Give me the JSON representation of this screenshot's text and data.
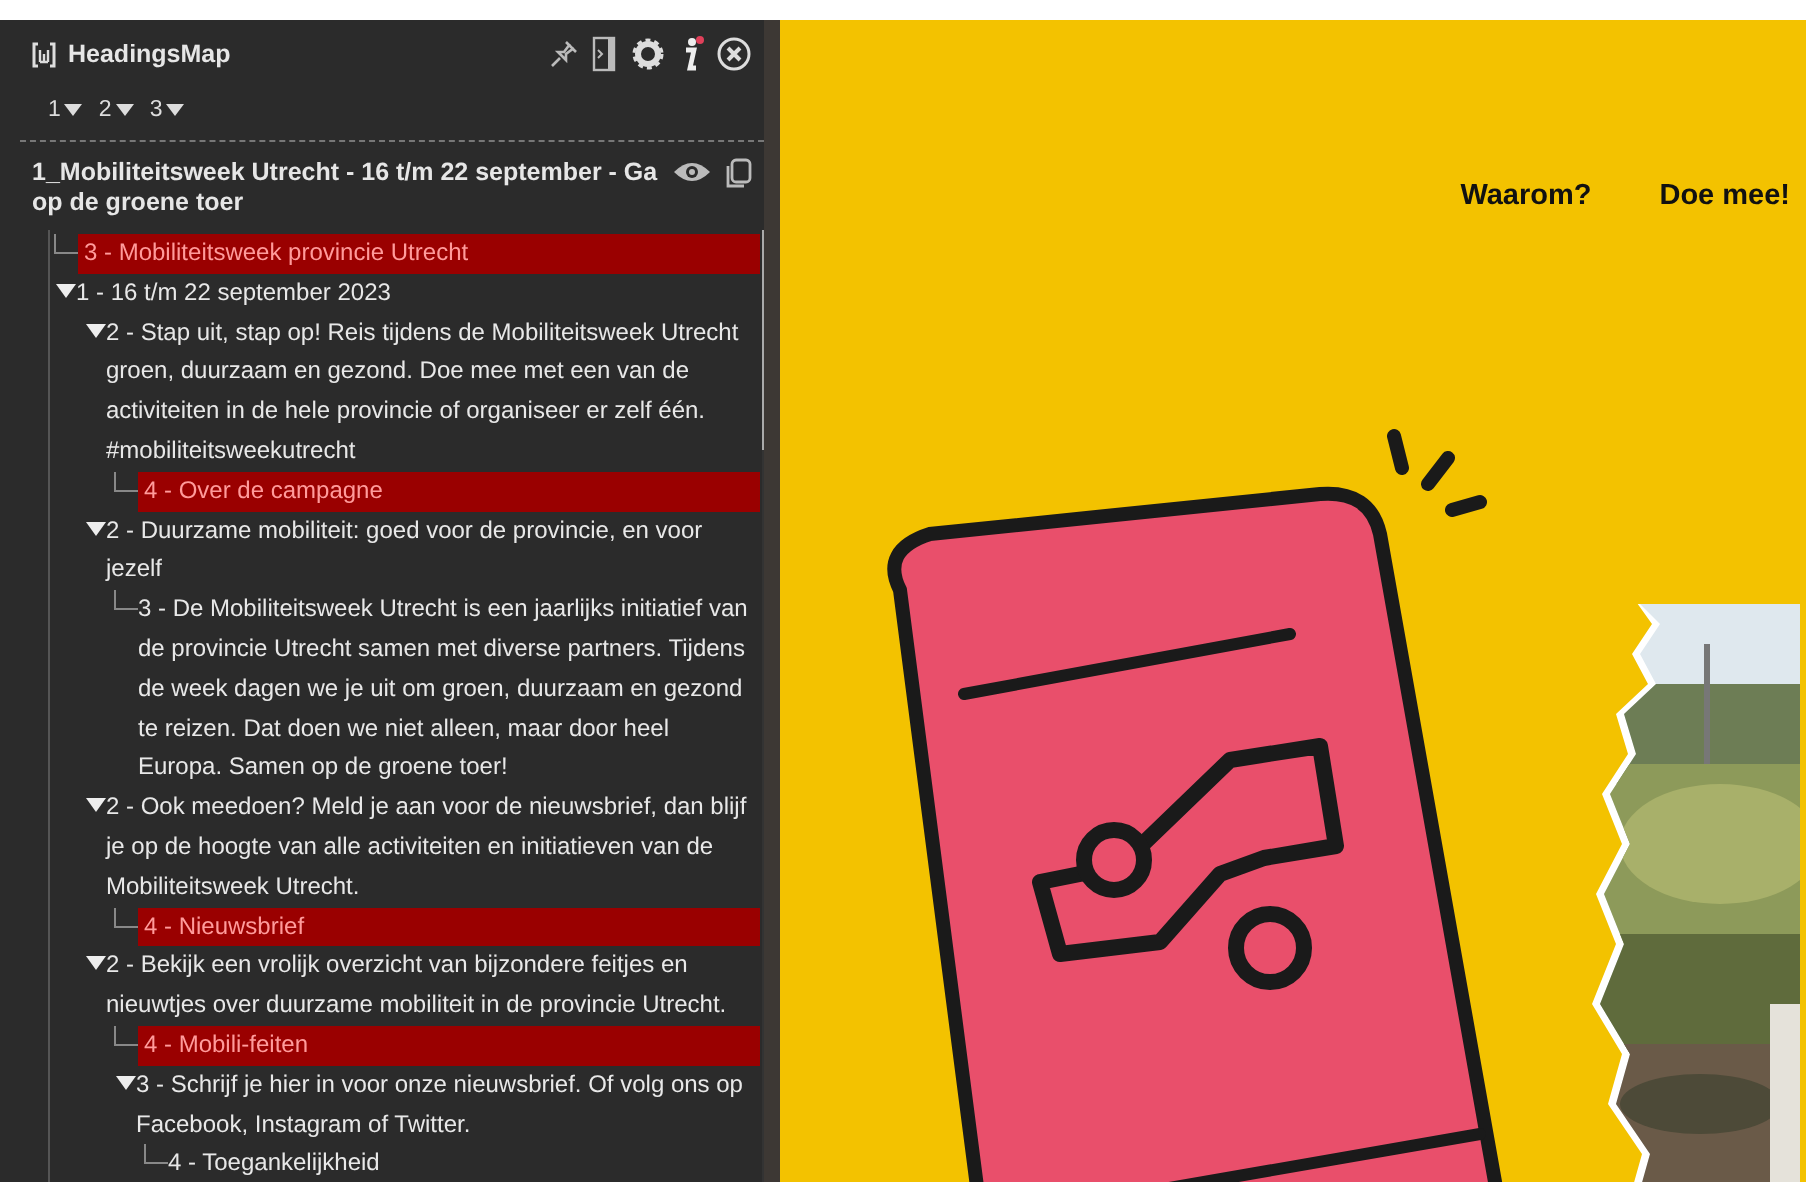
{
  "panel": {
    "title": "HeadingsMap",
    "levels": [
      {
        "label": "1"
      },
      {
        "label": "2"
      },
      {
        "label": "3"
      }
    ],
    "page_title": "1_Mobiliteitsweek Utrecht - 16 t/m 22 september - Ga op de groene toer",
    "tree": [
      {
        "text": "3 - Mobiliteitsweek provincie Utrecht",
        "flagged": true
      },
      {
        "text": "1 - 16 t/m 22 september 2023",
        "flagged": false,
        "expanded": true,
        "children": [
          {
            "text": "2 - Stap uit, stap op! Reis tijdens de Mobiliteitsweek Utrecht groen, duurzaam en gezond. Doe mee met een van de activiteiten in de hele provincie of organiseer er zelf één. #mobiliteitsweekutrecht",
            "flagged": false,
            "expanded": true,
            "children": [
              {
                "text": "4 - Over de campagne",
                "flagged": true
              }
            ]
          },
          {
            "text": "2 - Duurzame mobiliteit: goed voor de provincie, en voor jezelf",
            "flagged": false,
            "expanded": true,
            "children": [
              {
                "text": "3 - De Mobiliteitsweek Utrecht is een jaarlijks initiatief van de provincie Utrecht samen met diverse partners. Tijdens de week dagen we je uit om groen, duurzaam en gezond te reizen. Dat doen we niet alleen, maar door heel Europa. Samen op de groene toer!",
                "flagged": false
              }
            ]
          },
          {
            "text": "2 - Ook meedoen? Meld je aan voor de nieuwsbrief, dan blijf je op de hoogte van alle activiteiten en initiatieven van de Mobiliteitsweek Utrecht.",
            "flagged": false,
            "expanded": true,
            "children": [
              {
                "text": "4 - Nieuwsbrief",
                "flagged": true
              }
            ]
          },
          {
            "text": "2 - Bekijk een vrolijk overzicht van bijzondere feitjes en nieuwtjes over duurzame mobiliteit in de provincie Utrecht.",
            "flagged": false,
            "expanded": true,
            "children": [
              {
                "text": "4 - Mobili-feiten",
                "flagged": true
              },
              {
                "text": "3 - Schrijf je hier in voor onze nieuwsbrief. Of volg ons op Facebook, Instagram of Twitter.",
                "flagged": false,
                "expanded": true,
                "children": [
                  {
                    "text": "4 - Toegankelijkheid",
                    "flagged": false
                  }
                ]
              }
            ]
          }
        ]
      }
    ]
  },
  "site": {
    "nav": [
      "Waarom?",
      "Doe mee!"
    ],
    "hero": {
      "kind": "picture"
    }
  }
}
